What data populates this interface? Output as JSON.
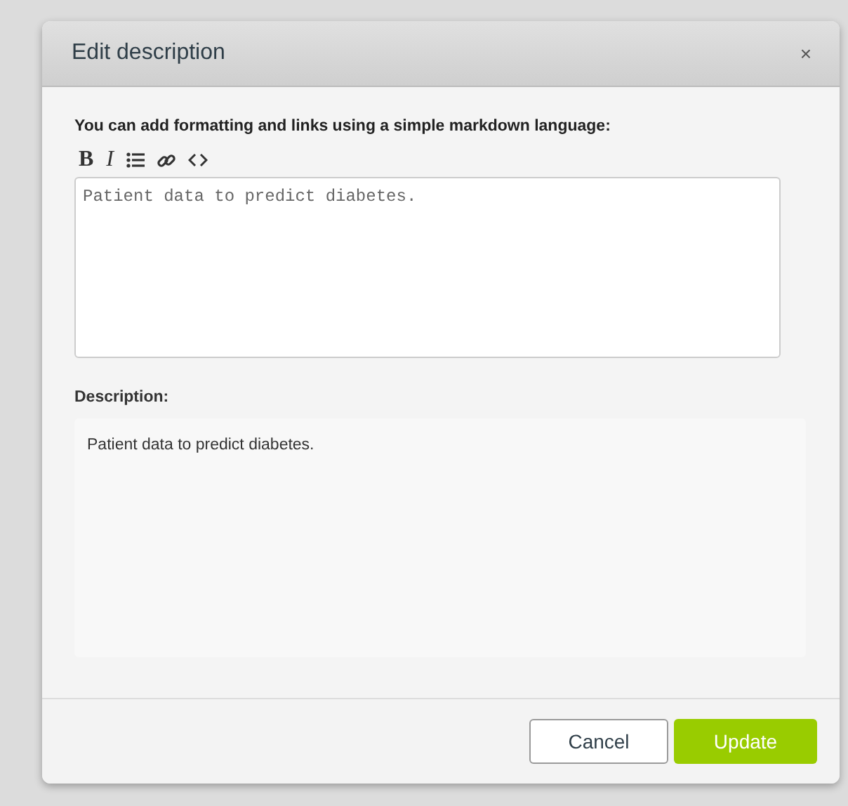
{
  "dialog": {
    "title": "Edit description",
    "close": "×"
  },
  "hint": "You can add formatting and links using a simple markdown language:",
  "toolbar": [
    {
      "kind": "bold",
      "label": "B"
    },
    {
      "kind": "italic",
      "label": "I"
    },
    {
      "kind": "list"
    },
    {
      "kind": "link"
    },
    {
      "kind": "code"
    }
  ],
  "editor": {
    "value": "Patient data to predict diabetes."
  },
  "preview": {
    "label": "Description:",
    "text": "Patient data to predict diabetes."
  },
  "buttons": [
    {
      "kind": "secondary",
      "label": "Cancel"
    },
    {
      "kind": "primary",
      "label": "Update"
    }
  ]
}
